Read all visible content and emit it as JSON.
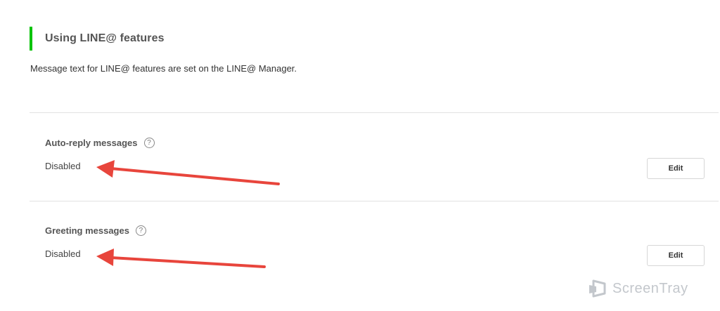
{
  "section": {
    "title": "Using LINE@ features",
    "description": "Message text for LINE@ features are set on the LINE@ Manager."
  },
  "settings": [
    {
      "label": "Auto-reply messages",
      "help_icon": "?",
      "status": "Disabled",
      "edit_label": "Edit"
    },
    {
      "label": "Greeting messages",
      "help_icon": "?",
      "status": "Disabled",
      "edit_label": "Edit"
    }
  ],
  "watermark": {
    "text": "ScreenTray"
  },
  "colors": {
    "accent": "#00c300",
    "annotation_arrow": "#e8453c",
    "divider": "#e2e2e2",
    "watermark": "#c3c7cc"
  },
  "icons": {
    "help": "question-circle-icon",
    "annotation": "red-arrow-icon",
    "watermark_logo": "screentray-logo-icon"
  }
}
